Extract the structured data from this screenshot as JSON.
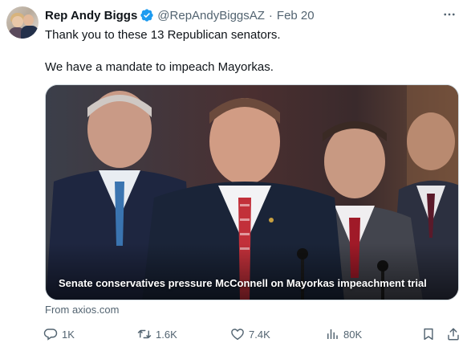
{
  "post": {
    "display_name": "Rep Andy Biggs",
    "handle": "@RepAndyBiggsAZ",
    "separator": "·",
    "date": "Feb 20",
    "text_line1": "Thank you to these 13 Republican senators.",
    "text_line2": "We have a mandate to impeach Mayorkas.",
    "verified_color": "#1d9bf0"
  },
  "card": {
    "title": "Senate conservatives pressure McConnell on Mayorkas impeachment trial",
    "source": "From axios.com"
  },
  "actions": {
    "replies": "1K",
    "reposts": "1.6K",
    "likes": "7.4K",
    "views": "80K"
  },
  "icons": {
    "reply": "reply-icon",
    "repost": "repost-icon",
    "like": "heart-icon",
    "views": "views-icon",
    "bookmark": "bookmark-icon",
    "share": "share-icon",
    "more": "more-icon"
  }
}
